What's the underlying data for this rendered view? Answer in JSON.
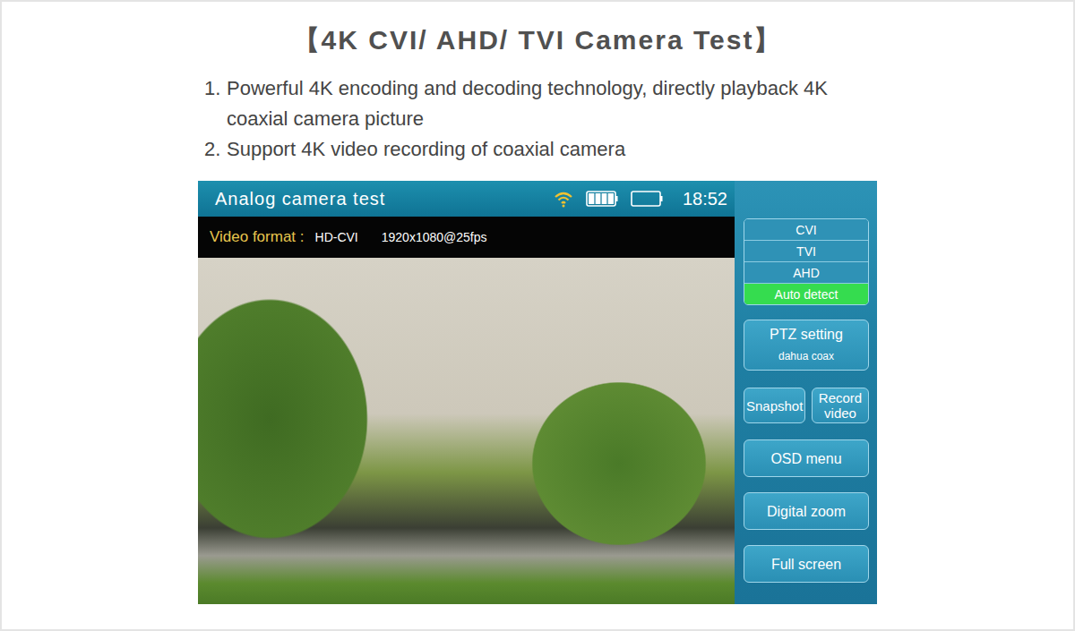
{
  "title": "【4K CVI/ AHD/ TVI Camera Test】",
  "features": [
    {
      "number": "1.",
      "text": "Powerful 4K encoding and decoding technology, directly playback 4K coaxial camera picture"
    },
    {
      "number": "2.",
      "text": "Support 4K video recording of coaxial camera"
    }
  ],
  "screen": {
    "title": "Analog camera test",
    "batteries": [
      {
        "level": 1
      },
      {
        "level": 0
      }
    ],
    "time": "18:52",
    "video_format": {
      "label": "Video format :",
      "format": "HD-CVI",
      "resolution": "1920x1080@25fps"
    },
    "formats": [
      {
        "label": "CVI",
        "selected": false
      },
      {
        "label": "TVI",
        "selected": false
      },
      {
        "label": "AHD",
        "selected": false
      },
      {
        "label": "Auto detect",
        "selected": true
      }
    ],
    "ptz": {
      "label": "PTZ setting",
      "protocol": "dahua coax"
    },
    "media_buttons": [
      "Snapshot",
      "Record video"
    ],
    "buttons": [
      "OSD menu",
      "Digital zoom",
      "Full screen"
    ]
  }
}
